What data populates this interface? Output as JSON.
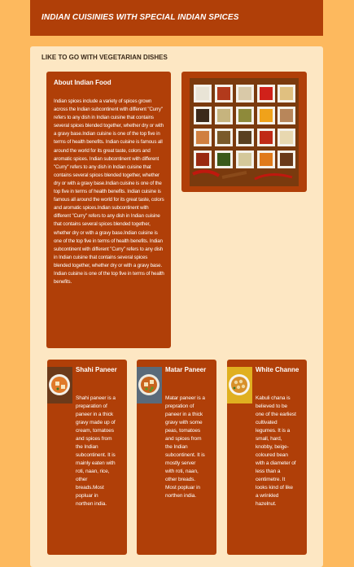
{
  "header": {
    "title": "INDIAN CUISINIES WITH SPECIAL INDIAN SPICES"
  },
  "main": {
    "subtitle": "LIKE TO GO WITH VEGETARIAN DISHES",
    "about": {
      "heading": "About Indian Food",
      "text": "Indian spices include a variety of spices grown across the Indian subcontinent with different \"Curry\" refers to any dish in Indian cuisine that contains several spices blended together, whether dry or with a gravy base.Indian cuisine is one of the top five in terms of health benefits. Indian cuisine is famous all around the world for its great taste, colors and aromatic spices. Indian subcontinent with different \"Curry\" refers to any dish in Indian cuisine that contains several spices blended together, whether dry or with a gravy base.Indian cuisine is one of the top five in terms of health benefits. Indian cuisine is famous all around the world for its great taste, colors and aromatic spices.Indian subcontinent with different \"Curry\" refers to any dish in Indian cuisine that contains several spices blended together, whether dry or with a gravy base.Indian cuisine is one of the top five in terms of health benefits. Indian subcontinent with different \"Curry\" refers to any dish in Indian cuisine that contains several spices blended together, whether dry or with a gravy base. Indian cuisine is one of the top five in terms of health benefits."
    },
    "dishes": [
      {
        "title": "Shahi Paneer",
        "description": "Shahi paneer is a preparation of paneer in a thick gravy made up of cream, tomatoes and spices from the Indian subcontinent. It is mainly eaten with roti, naan, rice, other breads.Most popluar in northen india."
      },
      {
        "title": "Matar Paneer",
        "description": "Matar paneer is a prepration of paneer in a thick gravy with some peas, tomatoes and spices from the Indian subcontinent. It is mostly server with roti, naan, other breads. Most popluar in northen india."
      },
      {
        "title": "White Channe",
        "description": "Kabuli chana is believed to be one of the earliest cultivated legumes. It is a small, hard, knobby, beige-coloured bean with a diameter of less than a centimetre. It looks kind of like a wrinkled hazelnut."
      }
    ]
  },
  "colors": {
    "page_bg": "#fdb95e",
    "panel_bg": "#fde7c3",
    "card_bg": "#b03f08",
    "text_light": "#ffffff"
  }
}
